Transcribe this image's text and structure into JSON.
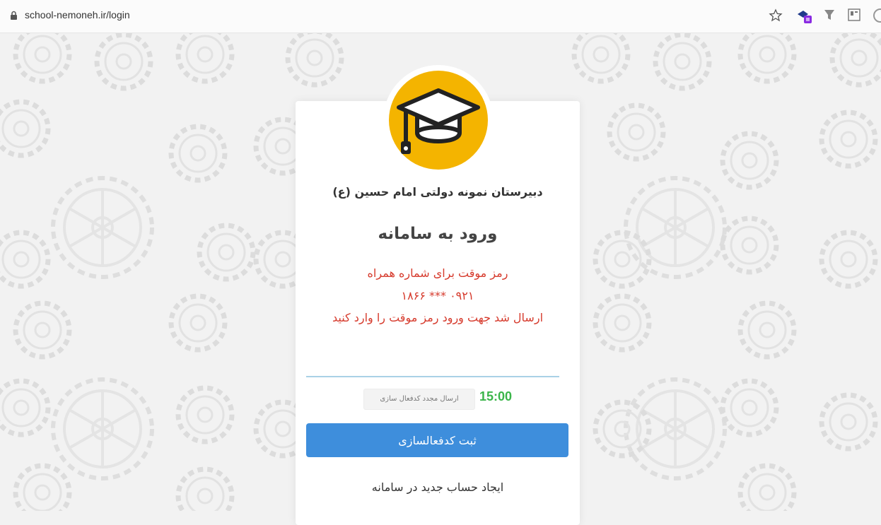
{
  "browser": {
    "url": "school-nemoneh.ir/login"
  },
  "card": {
    "school_name": "دبیرستان نمونه دولتی امام حسین (ع)",
    "title": "ورود به سامانه",
    "message_line1": "رمز موقت برای شماره همراه",
    "message_line2": "۰۹۲۱ *** ۱۸۶۶",
    "message_line3": "ارسال شد جهت ورود رمز موقت را وارد کنید",
    "code_input_value": "",
    "timer": "15:00",
    "resend_label": "ارسال مجدد کدفعال سازی",
    "submit_label": "ثبت کدفعالسازی",
    "create_account_label": "ایجاد حساب جدید در سامانه"
  },
  "colors": {
    "logo_bg": "#f4b400",
    "accent_button": "#3e8edc",
    "message_red": "#d63a2c",
    "timer_green": "#3bb54a"
  },
  "icons": [
    "lock-icon",
    "star-icon",
    "extension-icon",
    "filter-icon",
    "reader-icon",
    "graduation-cap-icon",
    "gear-icon"
  ]
}
